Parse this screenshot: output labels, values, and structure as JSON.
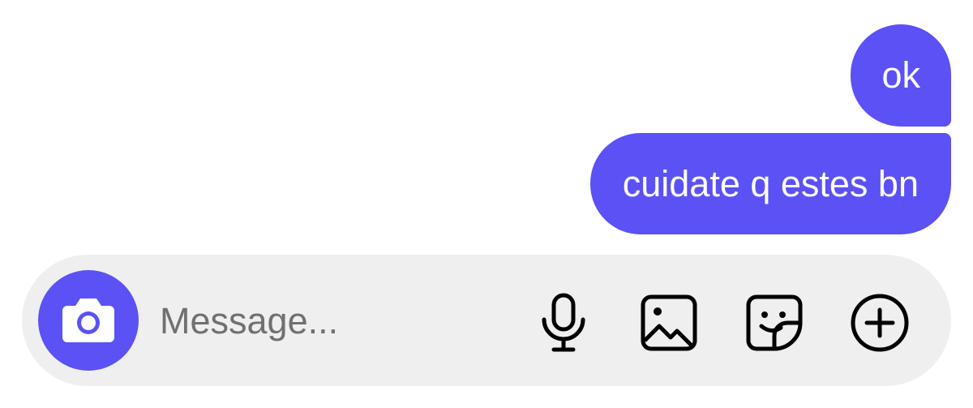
{
  "messages": [
    {
      "text": "ok",
      "sender": "me"
    },
    {
      "text": "cuidate q estes bn",
      "sender": "me"
    }
  ],
  "composer": {
    "placeholder": "Message...",
    "value": "",
    "icons": {
      "camera": "camera-icon",
      "mic": "microphone-icon",
      "gallery": "gallery-icon",
      "sticker": "sticker-icon",
      "plus": "plus-circle-icon"
    }
  },
  "colors": {
    "accent": "#5b51f5",
    "composer_bg": "#efefef",
    "bubble_text": "#ffffff",
    "placeholder": "#707070"
  }
}
